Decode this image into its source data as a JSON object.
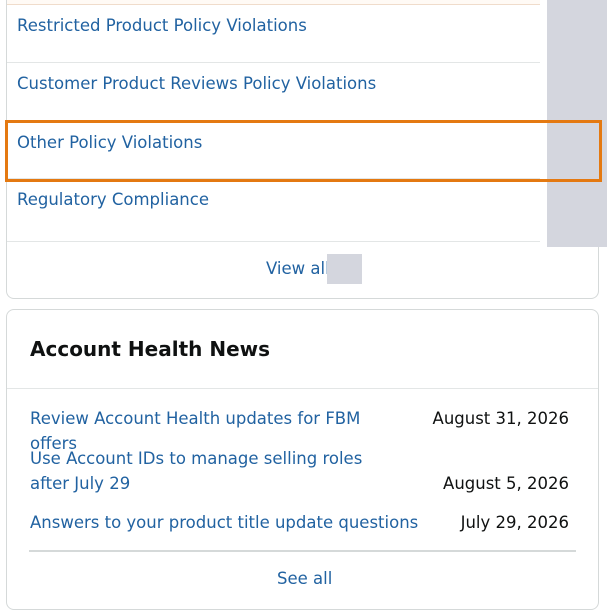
{
  "policy_list": {
    "items": [
      {
        "label": "Restricted Product Policy Violations"
      },
      {
        "label": "Customer Product Reviews Policy Violations"
      },
      {
        "label": "Other Policy Violations",
        "highlighted": true
      },
      {
        "label": "Regulatory Compliance"
      }
    ],
    "view_all_label": "View all"
  },
  "news": {
    "title": "Account Health News",
    "items": [
      {
        "headline": "Review Account Health updates for FBM offers",
        "date": "August 31, 2026"
      },
      {
        "headline": "Use Account IDs to manage selling roles after July 29",
        "date": "August 5, 2026"
      },
      {
        "headline": "Answers to your product title update questions",
        "date": "July 29, 2026"
      }
    ],
    "see_all_label": "See all"
  },
  "colors": {
    "link": "#2162a1",
    "text": "#0f1111",
    "highlight": "#e47911",
    "scrollbar": "#d4d6de",
    "border": "#d5d9d9"
  }
}
